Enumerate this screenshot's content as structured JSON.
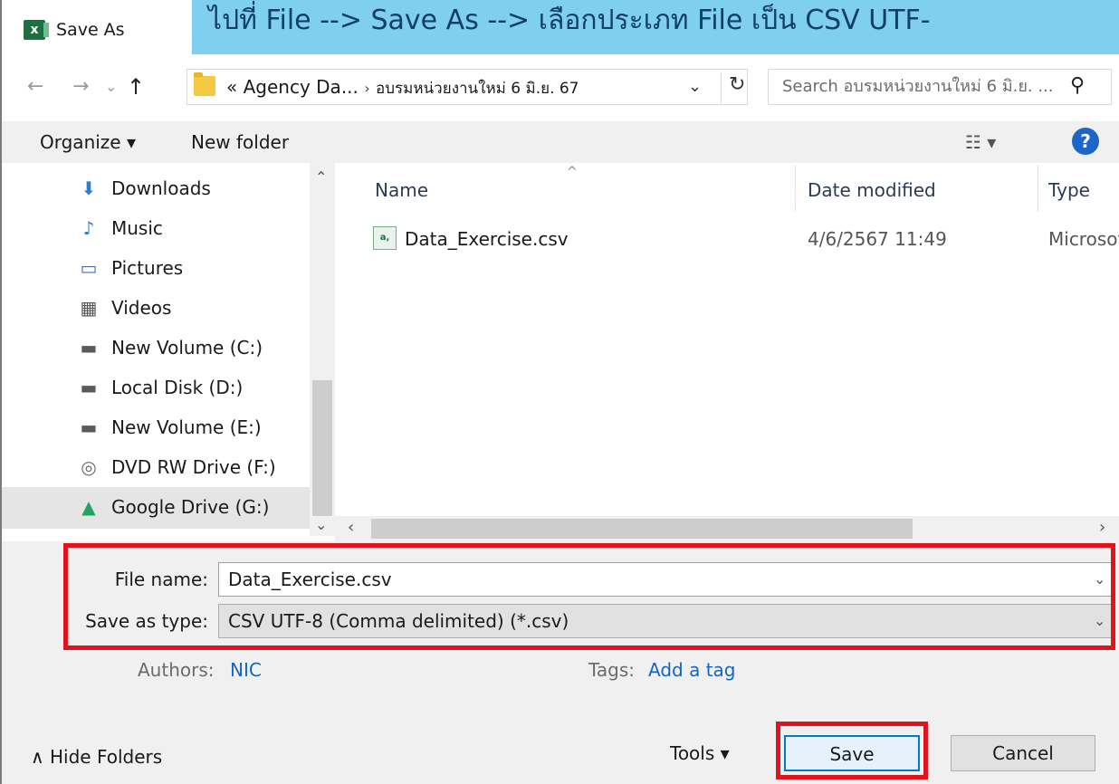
{
  "window": {
    "title": "Save As",
    "app_icon": "excel-icon",
    "app_icon_text": "x"
  },
  "annotation": {
    "banner_text": "ไปที่ File --> Save As --> เลือกประเภท File เป็น CSV UTF-"
  },
  "address_bar": {
    "back_glyph": "←",
    "forward_glyph": "→",
    "recent_glyph": "⌄",
    "up_glyph": "↑",
    "path_prefix": "«",
    "path_parent": "Agency Da...",
    "path_separator": "›",
    "path_current": "อบรมหน่วยงานใหม่ 6 มิ.ย. 67",
    "dropdown_glyph": "⌄",
    "refresh_glyph": "↻"
  },
  "search": {
    "placeholder": "Search อบรมหน่วยงานใหม่ 6 มิ.ย. ...",
    "icon_glyph": "⚲"
  },
  "toolbar": {
    "organize_label": "Organize ▾",
    "new_folder_label": "New folder",
    "view_glyph": "☷ ▾",
    "help_glyph": "?"
  },
  "nav_pane": {
    "items": [
      {
        "label": "Downloads",
        "icon": "download-arrow-icon",
        "glyph": "⬇",
        "color": "#2b7cd3"
      },
      {
        "label": "Music",
        "icon": "music-note-icon",
        "glyph": "♪",
        "color": "#2b7cd3"
      },
      {
        "label": "Pictures",
        "icon": "pictures-icon",
        "glyph": "▭",
        "color": "#4a6fa5"
      },
      {
        "label": "Videos",
        "icon": "film-icon",
        "glyph": "▦",
        "color": "#555555"
      },
      {
        "label": "New Volume (C:)",
        "icon": "windows-drive-icon",
        "glyph": "▬",
        "color": "#5a5a5a"
      },
      {
        "label": "Local Disk (D:)",
        "icon": "disk-drive-icon",
        "glyph": "▬",
        "color": "#5a5a5a"
      },
      {
        "label": "New Volume (E:)",
        "icon": "disk-drive-icon",
        "glyph": "▬",
        "color": "#5a5a5a"
      },
      {
        "label": "DVD RW Drive (F:)",
        "icon": "dvd-drive-icon",
        "glyph": "◎",
        "color": "#6a6a6a"
      },
      {
        "label": "Google Drive (G:)",
        "icon": "google-drive-icon",
        "glyph": "▲",
        "color": "#1fa463"
      }
    ],
    "selected_index": 8,
    "scroll_up_glyph": "⌃",
    "scroll_down_glyph": "⌄"
  },
  "file_list": {
    "columns": [
      "Name",
      "Date modified",
      "Type"
    ],
    "sort_caret": "^",
    "rows": [
      {
        "name": "Data_Exercise.csv",
        "date_modified": "4/6/2567 11:49",
        "type": "Microsoft Excel Comma Separated Values File",
        "icon": "csv-file-icon",
        "icon_text": "a,"
      }
    ],
    "scroll_left_glyph": "‹",
    "scroll_right_glyph": "›"
  },
  "form": {
    "file_name_label": "File name:",
    "file_name_value": "Data_Exercise.csv",
    "save_type_label": "Save as type:",
    "save_type_value": "CSV UTF-8 (Comma delimited) (*.csv)",
    "dropdown_glyph": "⌄",
    "authors_label": "Authors:",
    "authors_value": "NIC",
    "tags_label": "Tags:",
    "tags_value": "Add a tag"
  },
  "footer": {
    "hide_folders_label": "∧  Hide Folders",
    "tools_label": "Tools  ▾",
    "save_label": "Save",
    "cancel_label": "Cancel"
  },
  "colors": {
    "banner": "#7fd0f0",
    "highlight_border": "#e0141a",
    "accent": "#0078d7",
    "link": "#1565c0"
  }
}
